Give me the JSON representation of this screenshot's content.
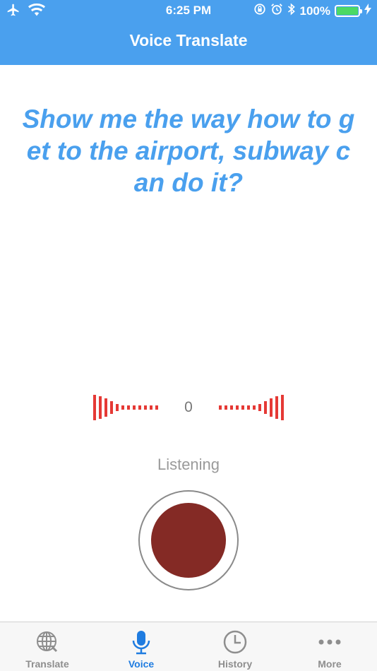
{
  "status_bar": {
    "time": "6:25 PM",
    "battery": "100%",
    "icons": [
      "airplane-icon",
      "wifi-icon",
      "rotation-lock-icon",
      "alarm-icon",
      "bluetooth-icon",
      "battery-icon",
      "charging-icon"
    ]
  },
  "header": {
    "title": "Voice Translate"
  },
  "main": {
    "phrase": "Show me the way how to get to the airport, subway can do it?",
    "level_count": "0",
    "status": "Listening"
  },
  "tabs": [
    {
      "label": "Translate",
      "icon": "globe-icon",
      "active": false
    },
    {
      "label": "Voice",
      "icon": "microphone-icon",
      "active": true
    },
    {
      "label": "History",
      "icon": "clock-icon",
      "active": false
    },
    {
      "label": "More",
      "icon": "more-icon",
      "active": false
    }
  ],
  "colors": {
    "accent": "#4aa0ee",
    "active_tab": "#1f7ce0",
    "meter": "#e53935",
    "record": "#842a25"
  }
}
